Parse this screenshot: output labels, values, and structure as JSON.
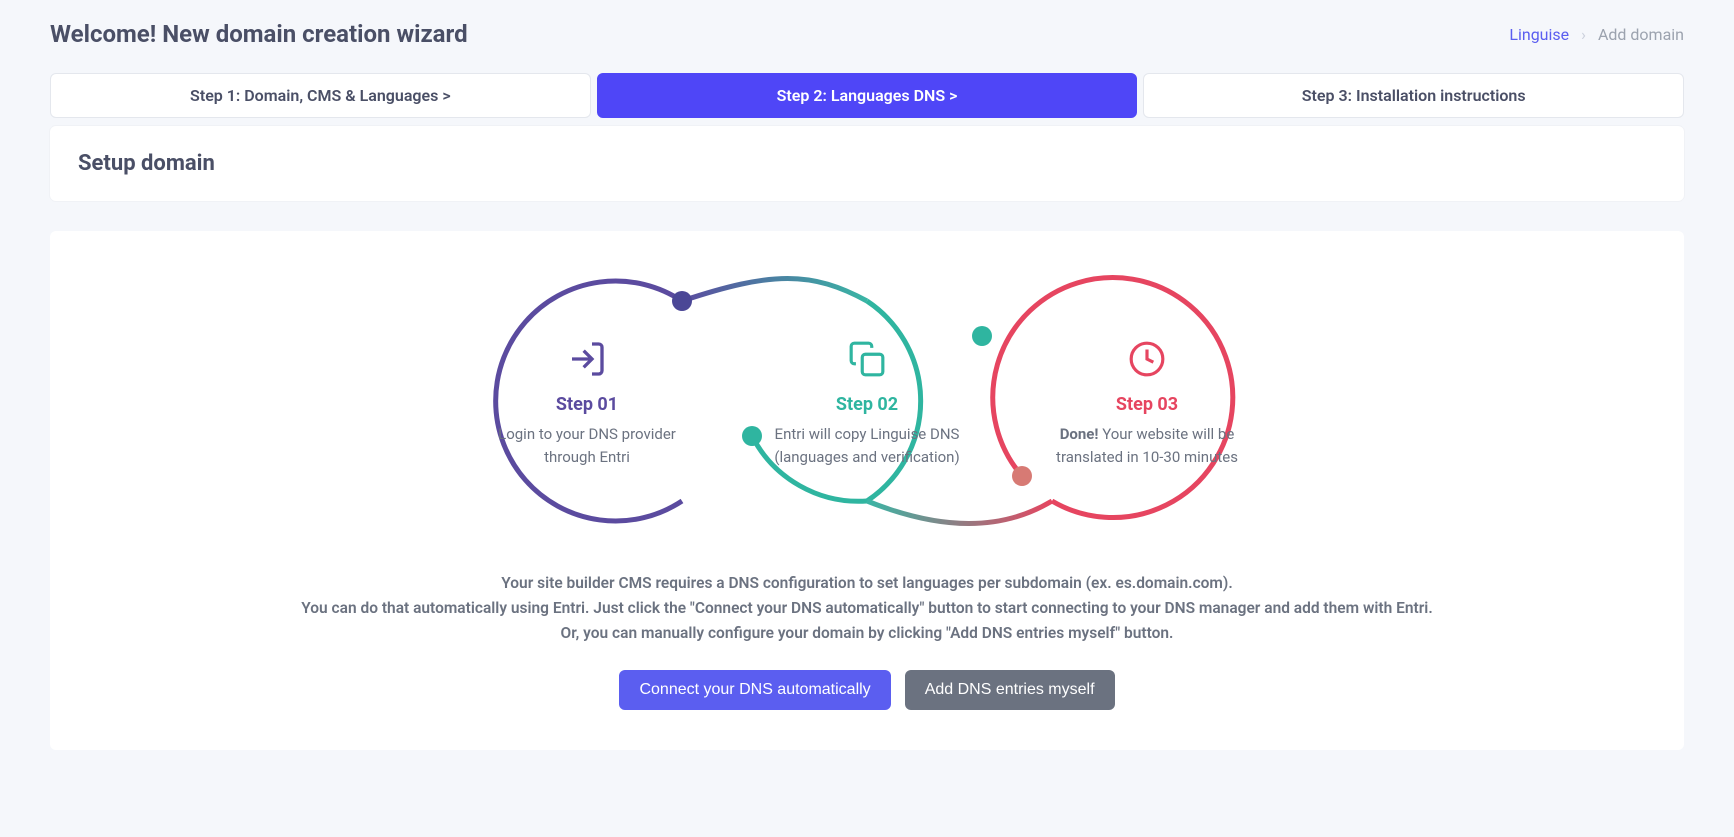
{
  "header": {
    "title": "Welcome! New domain creation wizard",
    "breadcrumb_link": "Linguise",
    "breadcrumb_current": "Add domain"
  },
  "tabs": [
    {
      "label": "Step 1: Domain, CMS & Languages  >"
    },
    {
      "label": "Step 2: Languages DNS  >"
    },
    {
      "label": "Step 3: Installation instructions"
    }
  ],
  "setup_heading": "Setup domain",
  "diagram": {
    "step1": {
      "label": "Step 01",
      "desc": "Login to your DNS provider through Entri"
    },
    "step2": {
      "label": "Step 02",
      "desc": "Entri will copy Linguise DNS (languages and verification)"
    },
    "step3": {
      "label": "Step 03",
      "desc_bold": "Done!",
      "desc_rest": " Your website will be translated in 10-30 minutes"
    }
  },
  "instructions": {
    "line1": "Your site builder CMS requires a DNS configuration to set languages per subdomain (ex. es.domain.com).",
    "line2": "You can do that automatically using Entri. Just click the \"Connect your DNS automatically\" button to start connecting to your DNS manager and add them with Entri.",
    "line3": "Or, you can manually configure your domain by clicking \"Add DNS entries myself\" button."
  },
  "buttons": {
    "connect": "Connect your DNS automatically",
    "manual": "Add DNS entries myself"
  }
}
